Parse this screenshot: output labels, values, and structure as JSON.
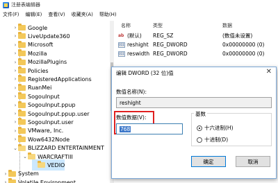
{
  "window": {
    "title": "注册表编辑器"
  },
  "menu": [
    "文件(F)",
    "编辑(E)",
    "查看(V)",
    "收藏夹(A)",
    "帮助(H)"
  ],
  "tree": {
    "items": [
      {
        "label": "Google",
        "expanded": false
      },
      {
        "label": "LiveUpdate360",
        "expanded": false
      },
      {
        "label": "Microsoft",
        "expanded": false
      },
      {
        "label": "Mozilla",
        "expanded": false
      },
      {
        "label": "MozillaPlugins",
        "expanded": false
      },
      {
        "label": "Policies",
        "expanded": false
      },
      {
        "label": "RegisteredApplications",
        "expanded": false
      },
      {
        "label": "RuanMei",
        "expanded": false
      },
      {
        "label": "SogouInput",
        "expanded": false
      },
      {
        "label": "SogouInput.ppup",
        "expanded": false
      },
      {
        "label": "SogouInput.ppup.user",
        "expanded": false
      },
      {
        "label": "SogouInput.user",
        "expanded": false
      },
      {
        "label": "VMware, Inc.",
        "expanded": false
      },
      {
        "label": "Wow6432Node",
        "expanded": false
      },
      {
        "label": "BLIZZARD ENTERTAINMENT",
        "expanded": true
      },
      {
        "label": "WARCRAFTIII",
        "expanded": true
      },
      {
        "label": "VEDIO",
        "expanded": false,
        "selected": true
      },
      {
        "label": "System",
        "expanded": false
      },
      {
        "label": "Volatile Environment",
        "expanded": false
      }
    ]
  },
  "list": {
    "headers": {
      "name": "名称",
      "type": "类型",
      "data": "数据"
    },
    "rows": [
      {
        "name": "(默认)",
        "type": "REG_SZ",
        "data": "(数值未设置)",
        "icon": "string-value-icon"
      },
      {
        "name": "reshight",
        "type": "REG_DWORD",
        "data": "0x00000000 (0)",
        "icon": "dword-value-icon"
      },
      {
        "name": "reswidth",
        "type": "REG_DWORD",
        "data": "0x00000000 (0)",
        "icon": "dword-value-icon"
      }
    ]
  },
  "dialog": {
    "title": "编辑 DWORD (32 位)值",
    "name_label": "数值名称(N):",
    "name_value": "reshight",
    "data_label": "数值数据(V):",
    "data_value": "768",
    "base_label": "基数",
    "radio_hex": "十六进制(H)",
    "radio_dec": "十进制(D)",
    "selected_base": "hex",
    "ok": "确定",
    "cancel": "取消"
  },
  "colors": {
    "highlight": "#e02020",
    "selection": "#3a76c9"
  }
}
